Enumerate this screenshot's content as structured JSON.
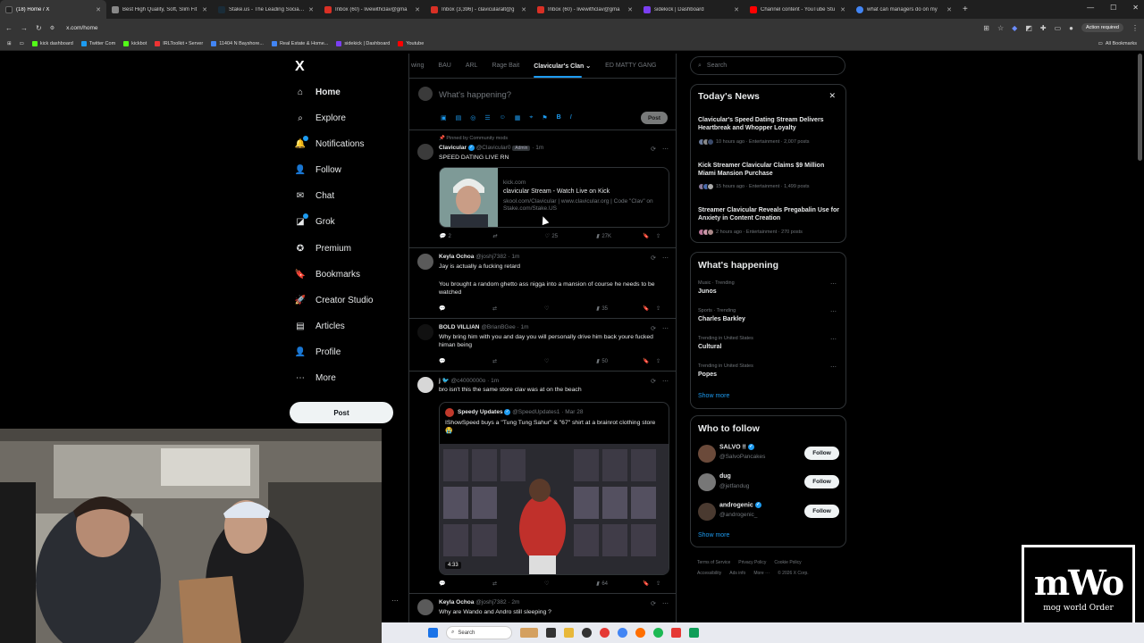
{
  "browser": {
    "tabs": [
      {
        "title": "(18) Home / X",
        "color": "#222",
        "active": true
      },
      {
        "title": "Best High Quality, Soft, Slim Fit",
        "color": "#888"
      },
      {
        "title": "Stake.us - The Leading Social C",
        "color": "#1a2c38"
      },
      {
        "title": "Inbox (60) - livewithclav@gma",
        "color": "#d93025"
      },
      {
        "title": "Inbox (3,396) - clavicularalt@g",
        "color": "#d93025"
      },
      {
        "title": "Inbox (60) - livewithclav@gma",
        "color": "#d93025"
      },
      {
        "title": "sidekick | Dashboard",
        "color": "#7b3ff2"
      },
      {
        "title": "Channel content - YouTube Stu",
        "color": "#ff0000"
      },
      {
        "title": "what can managers do on my",
        "color": "#4285f4"
      }
    ],
    "new_tab": "+",
    "url": "x.com/home",
    "action_required": "Action required",
    "bookmarks": [
      {
        "label": "kick dashboard",
        "color": "#53fc18"
      },
      {
        "label": "Twitter Com",
        "color": "#1d9bf0"
      },
      {
        "label": "kickbot",
        "color": "#53fc18"
      },
      {
        "label": "IRLToolkit • Server",
        "color": "#e33"
      },
      {
        "label": "11404 N Bayshore...",
        "color": "#4285f4"
      },
      {
        "label": "Real Estate & Home...",
        "color": "#4285f4"
      },
      {
        "label": "sidekick | Dashboard",
        "color": "#7b3ff2"
      },
      {
        "label": "Youtube",
        "color": "#ff0000"
      }
    ],
    "all_bookmarks": "All Bookmarks"
  },
  "nav": {
    "logo": "X",
    "items": [
      {
        "label": "Home",
        "icon": "home-icon",
        "glyph": "⌂"
      },
      {
        "label": "Explore",
        "icon": "search-icon",
        "glyph": "⌕"
      },
      {
        "label": "Notifications",
        "icon": "bell-icon",
        "glyph": "🔔"
      },
      {
        "label": "Follow",
        "icon": "follow-icon",
        "glyph": "👤"
      },
      {
        "label": "Chat",
        "icon": "mail-icon",
        "glyph": "✉"
      },
      {
        "label": "Grok",
        "icon": "grok-icon",
        "glyph": "◪"
      },
      {
        "label": "Premium",
        "icon": "premium-icon",
        "glyph": "✪"
      },
      {
        "label": "Bookmarks",
        "icon": "bookmark-icon",
        "glyph": "🔖"
      },
      {
        "label": "Creator Studio",
        "icon": "rocket-icon",
        "glyph": "🚀"
      },
      {
        "label": "Articles",
        "icon": "articles-icon",
        "glyph": "▤"
      },
      {
        "label": "Profile",
        "icon": "profile-icon",
        "glyph": "👤"
      },
      {
        "label": "More",
        "icon": "more-icon",
        "glyph": "⋯"
      }
    ],
    "post": "Post"
  },
  "feed": {
    "tabs": [
      "wing",
      "BAU",
      "ARL",
      "Rage Bait",
      "Clavicular's Clan",
      "ED MATTY GANG"
    ],
    "compose_placeholder": "What's happening?",
    "post": "Post",
    "tweets": [
      {
        "pinned": "Pinned by Community mods",
        "name": "Clavicular",
        "handle": "@Clavicular0",
        "badge": "Admin",
        "time": "· 1m",
        "text": "SPEED DATING LIVE RN",
        "card": {
          "domain": "kick.com",
          "title": "clavicular Stream - Watch Live on Kick",
          "desc": "skool.com/Clavicular | www.clavicular.org | Code \"Clav\" on Stake.com/Stake.US"
        },
        "replies": "2",
        "likes": "25",
        "views": "27K"
      },
      {
        "name": "Keyla Ochoa",
        "handle": "@joshj7382",
        "time": "· 1m",
        "text": "Jay is actually a fucking retard",
        "text2": "You brought a random ghetto ass nigga into a mansion of course he needs to be watched",
        "views": "35"
      },
      {
        "name": "BOLD VILLIAN",
        "handle": "@BrianBGee",
        "time": "· 1m",
        "text": "Why bring him with you and day you will personally drive him back youre fucked himan being",
        "views": "50"
      },
      {
        "name": "j 🐦",
        "handle": "@c4000000o",
        "time": "· 1m",
        "text": "bro isn't this the same store clav was at on the beach",
        "quote": {
          "name": "Speedy Updates",
          "handle": "@SpeedUpdates1",
          "time": "· Mar 28",
          "text": "IShowSpeed buys a \"Tung Tung Sahur\" & \"67\" shirt at a brainrot clothing store 😭",
          "duration": "4:33"
        },
        "views": "64"
      },
      {
        "name": "Keyla Ochoa",
        "handle": "@joshj7382",
        "time": "· 2m",
        "text": "Why are Wando and Andro still sleeping ?"
      }
    ]
  },
  "right": {
    "search_placeholder": "Search",
    "news": {
      "title": "Today's News",
      "items": [
        {
          "title": "Clavicular's Speed Dating Stream Delivers Heartbreak and Whopper Loyalty",
          "meta": "10 hours ago · Entertainment · 2,007 posts"
        },
        {
          "title": "Kick Streamer Clavicular Claims $9 Million Miami Mansion Purchase",
          "meta": "15 hours ago · Entertainment · 1,499 posts"
        },
        {
          "title": "Streamer Clavicular Reveals Pregabalin Use for Anxiety in Content Creation",
          "meta": "2 hours ago · Entertainment · 270 posts"
        }
      ]
    },
    "happening": {
      "title": "What's happening",
      "items": [
        {
          "cat": "Music · Trending",
          "name": "Junos"
        },
        {
          "cat": "Sports · Trending",
          "name": "Charles Barkley"
        },
        {
          "cat": "Trending in United States",
          "name": "Cultural"
        },
        {
          "cat": "Trending in United States",
          "name": "Popes"
        }
      ],
      "show_more": "Show more"
    },
    "who": {
      "title": "Who to follow",
      "items": [
        {
          "name": "SALVO ‼",
          "handle": "@SalvoPancakes",
          "btn": "Follow"
        },
        {
          "name": "dug",
          "handle": "@jetfandug",
          "btn": "Follow"
        },
        {
          "name": "androgenic",
          "handle": "@androgenic_",
          "btn": "Follow"
        }
      ],
      "show_more": "Show more"
    },
    "footer": [
      "Terms of Service",
      "Privacy Policy",
      "Cookie Policy",
      "Accessibility",
      "Ads info",
      "More ···",
      "© 2026 X Corp."
    ]
  },
  "overlay": {
    "logo_big": "mWo",
    "logo_small": "mog world Order"
  },
  "taskbar": {
    "search": "Search"
  }
}
